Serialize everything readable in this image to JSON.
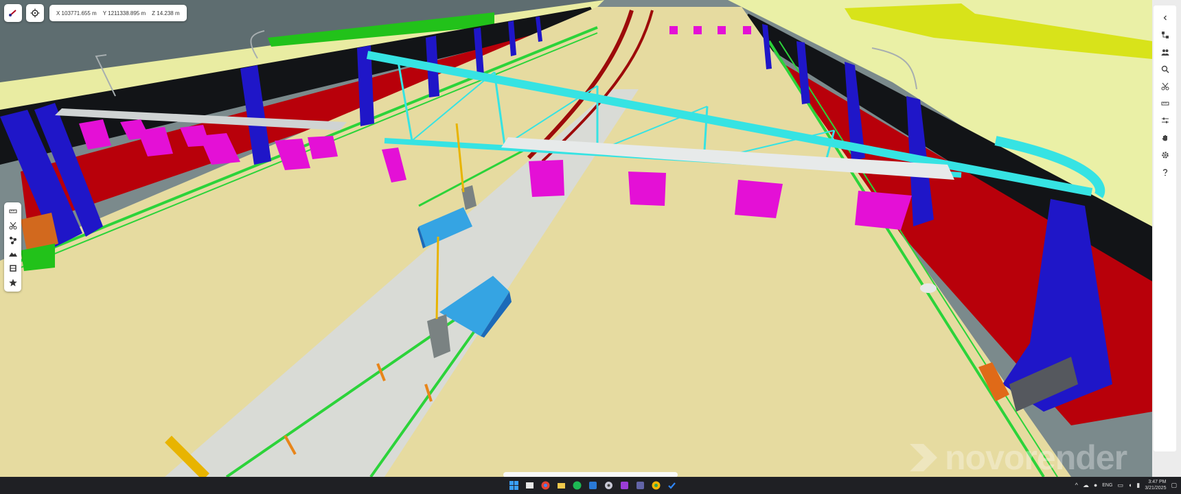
{
  "toolbar": {
    "home_icon": "measure-arrow-icon",
    "locate_icon": "crosshair-icon"
  },
  "coordinates": {
    "x": "X  103771.655 m",
    "y": "Y  1211338.895 m",
    "z": "Z  14.238 m"
  },
  "left_toolbar": {
    "items": [
      {
        "icon": "ruler-icon"
      },
      {
        "icon": "scissors-icon"
      },
      {
        "icon": "nodes-icon"
      },
      {
        "icon": "terrain-icon"
      },
      {
        "icon": "layers-icon"
      },
      {
        "icon": "star-icon"
      }
    ]
  },
  "right_panel": {
    "items": [
      {
        "icon": "chevron-left-icon"
      },
      {
        "icon": "model-tree-icon"
      },
      {
        "icon": "users-icon"
      },
      {
        "icon": "search-icon"
      },
      {
        "icon": "scissors-icon"
      },
      {
        "icon": "ruler-icon"
      },
      {
        "icon": "sliders-icon"
      },
      {
        "icon": "hand-icon"
      },
      {
        "icon": "gear-icon"
      },
      {
        "icon": "help-icon"
      }
    ]
  },
  "watermark": {
    "text": "novorender"
  },
  "taskbar": {
    "apps": [
      {
        "icon": "windows-start-icon",
        "color": "#3aa0ff"
      },
      {
        "icon": "file-explorer-icon",
        "color": "#e8e8e8"
      },
      {
        "icon": "chrome-icon",
        "color": "#e34133"
      },
      {
        "icon": "folder-icon",
        "color": "#f2c94c"
      },
      {
        "icon": "spotify-icon",
        "color": "#1db954"
      },
      {
        "icon": "outlook-icon",
        "color": "#2a7ad6"
      },
      {
        "icon": "camera-icon",
        "color": "#c9c9d6"
      },
      {
        "icon": "onenote-icon",
        "color": "#9b3dd6"
      },
      {
        "icon": "teams-icon",
        "color": "#6264a7"
      },
      {
        "icon": "chrome-icon",
        "color": "#f4b400"
      },
      {
        "icon": "todo-icon",
        "color": "#2f87ff"
      }
    ],
    "language": "ENG",
    "time": "3:47 PM",
    "date": "3/21/2025"
  },
  "colors": {
    "sky_terrain": "#6f7d7f",
    "road": "#e6dba0",
    "truss": "#36e3e3",
    "marker": "#e410d6",
    "barrier": "#1f16c8",
    "wall": "#b8000a",
    "rail": "#2cd33a",
    "walkway": "#d9dbd6"
  }
}
